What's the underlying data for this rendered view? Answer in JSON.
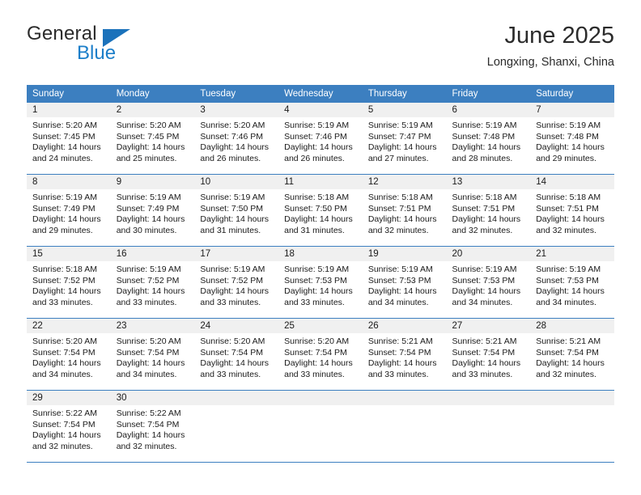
{
  "brand": {
    "name_top": "General",
    "name_bottom": "Blue",
    "triangle_color": "#1b72bb",
    "blue_text_color": "#1b7ec9"
  },
  "header": {
    "title": "June 2025",
    "subtitle": "Longxing, Shanxi, China"
  },
  "theme": {
    "header_bg": "#3c7fc0",
    "header_text": "#ffffff",
    "daynum_bg": "#f0f0f0",
    "cell_bg": "#ffffff",
    "rule_color": "#3c7fc0",
    "body_text": "#1a1a1a"
  },
  "weekday_headers": [
    "Sunday",
    "Monday",
    "Tuesday",
    "Wednesday",
    "Thursday",
    "Friday",
    "Saturday"
  ],
  "weeks": [
    [
      {
        "day": "1",
        "sunrise": "Sunrise: 5:20 AM",
        "sunset": "Sunset: 7:45 PM",
        "daylight": "Daylight: 14 hours and 24 minutes."
      },
      {
        "day": "2",
        "sunrise": "Sunrise: 5:20 AM",
        "sunset": "Sunset: 7:45 PM",
        "daylight": "Daylight: 14 hours and 25 minutes."
      },
      {
        "day": "3",
        "sunrise": "Sunrise: 5:20 AM",
        "sunset": "Sunset: 7:46 PM",
        "daylight": "Daylight: 14 hours and 26 minutes."
      },
      {
        "day": "4",
        "sunrise": "Sunrise: 5:19 AM",
        "sunset": "Sunset: 7:46 PM",
        "daylight": "Daylight: 14 hours and 26 minutes."
      },
      {
        "day": "5",
        "sunrise": "Sunrise: 5:19 AM",
        "sunset": "Sunset: 7:47 PM",
        "daylight": "Daylight: 14 hours and 27 minutes."
      },
      {
        "day": "6",
        "sunrise": "Sunrise: 5:19 AM",
        "sunset": "Sunset: 7:48 PM",
        "daylight": "Daylight: 14 hours and 28 minutes."
      },
      {
        "day": "7",
        "sunrise": "Sunrise: 5:19 AM",
        "sunset": "Sunset: 7:48 PM",
        "daylight": "Daylight: 14 hours and 29 minutes."
      }
    ],
    [
      {
        "day": "8",
        "sunrise": "Sunrise: 5:19 AM",
        "sunset": "Sunset: 7:49 PM",
        "daylight": "Daylight: 14 hours and 29 minutes."
      },
      {
        "day": "9",
        "sunrise": "Sunrise: 5:19 AM",
        "sunset": "Sunset: 7:49 PM",
        "daylight": "Daylight: 14 hours and 30 minutes."
      },
      {
        "day": "10",
        "sunrise": "Sunrise: 5:19 AM",
        "sunset": "Sunset: 7:50 PM",
        "daylight": "Daylight: 14 hours and 31 minutes."
      },
      {
        "day": "11",
        "sunrise": "Sunrise: 5:18 AM",
        "sunset": "Sunset: 7:50 PM",
        "daylight": "Daylight: 14 hours and 31 minutes."
      },
      {
        "day": "12",
        "sunrise": "Sunrise: 5:18 AM",
        "sunset": "Sunset: 7:51 PM",
        "daylight": "Daylight: 14 hours and 32 minutes."
      },
      {
        "day": "13",
        "sunrise": "Sunrise: 5:18 AM",
        "sunset": "Sunset: 7:51 PM",
        "daylight": "Daylight: 14 hours and 32 minutes."
      },
      {
        "day": "14",
        "sunrise": "Sunrise: 5:18 AM",
        "sunset": "Sunset: 7:51 PM",
        "daylight": "Daylight: 14 hours and 32 minutes."
      }
    ],
    [
      {
        "day": "15",
        "sunrise": "Sunrise: 5:18 AM",
        "sunset": "Sunset: 7:52 PM",
        "daylight": "Daylight: 14 hours and 33 minutes."
      },
      {
        "day": "16",
        "sunrise": "Sunrise: 5:19 AM",
        "sunset": "Sunset: 7:52 PM",
        "daylight": "Daylight: 14 hours and 33 minutes."
      },
      {
        "day": "17",
        "sunrise": "Sunrise: 5:19 AM",
        "sunset": "Sunset: 7:52 PM",
        "daylight": "Daylight: 14 hours and 33 minutes."
      },
      {
        "day": "18",
        "sunrise": "Sunrise: 5:19 AM",
        "sunset": "Sunset: 7:53 PM",
        "daylight": "Daylight: 14 hours and 33 minutes."
      },
      {
        "day": "19",
        "sunrise": "Sunrise: 5:19 AM",
        "sunset": "Sunset: 7:53 PM",
        "daylight": "Daylight: 14 hours and 34 minutes."
      },
      {
        "day": "20",
        "sunrise": "Sunrise: 5:19 AM",
        "sunset": "Sunset: 7:53 PM",
        "daylight": "Daylight: 14 hours and 34 minutes."
      },
      {
        "day": "21",
        "sunrise": "Sunrise: 5:19 AM",
        "sunset": "Sunset: 7:53 PM",
        "daylight": "Daylight: 14 hours and 34 minutes."
      }
    ],
    [
      {
        "day": "22",
        "sunrise": "Sunrise: 5:20 AM",
        "sunset": "Sunset: 7:54 PM",
        "daylight": "Daylight: 14 hours and 34 minutes."
      },
      {
        "day": "23",
        "sunrise": "Sunrise: 5:20 AM",
        "sunset": "Sunset: 7:54 PM",
        "daylight": "Daylight: 14 hours and 34 minutes."
      },
      {
        "day": "24",
        "sunrise": "Sunrise: 5:20 AM",
        "sunset": "Sunset: 7:54 PM",
        "daylight": "Daylight: 14 hours and 33 minutes."
      },
      {
        "day": "25",
        "sunrise": "Sunrise: 5:20 AM",
        "sunset": "Sunset: 7:54 PM",
        "daylight": "Daylight: 14 hours and 33 minutes."
      },
      {
        "day": "26",
        "sunrise": "Sunrise: 5:21 AM",
        "sunset": "Sunset: 7:54 PM",
        "daylight": "Daylight: 14 hours and 33 minutes."
      },
      {
        "day": "27",
        "sunrise": "Sunrise: 5:21 AM",
        "sunset": "Sunset: 7:54 PM",
        "daylight": "Daylight: 14 hours and 33 minutes."
      },
      {
        "day": "28",
        "sunrise": "Sunrise: 5:21 AM",
        "sunset": "Sunset: 7:54 PM",
        "daylight": "Daylight: 14 hours and 32 minutes."
      }
    ],
    [
      {
        "day": "29",
        "sunrise": "Sunrise: 5:22 AM",
        "sunset": "Sunset: 7:54 PM",
        "daylight": "Daylight: 14 hours and 32 minutes."
      },
      {
        "day": "30",
        "sunrise": "Sunrise: 5:22 AM",
        "sunset": "Sunset: 7:54 PM",
        "daylight": "Daylight: 14 hours and 32 minutes."
      },
      {
        "day": "",
        "sunrise": "",
        "sunset": "",
        "daylight": ""
      },
      {
        "day": "",
        "sunrise": "",
        "sunset": "",
        "daylight": ""
      },
      {
        "day": "",
        "sunrise": "",
        "sunset": "",
        "daylight": ""
      },
      {
        "day": "",
        "sunrise": "",
        "sunset": "",
        "daylight": ""
      },
      {
        "day": "",
        "sunrise": "",
        "sunset": "",
        "daylight": ""
      }
    ]
  ]
}
